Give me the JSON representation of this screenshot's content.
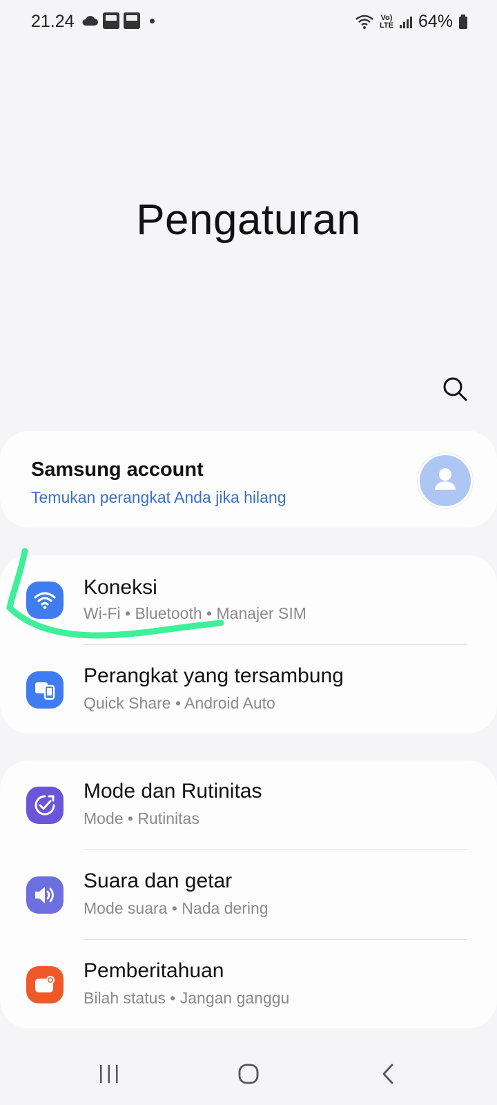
{
  "status_bar": {
    "time": "21.24",
    "battery_percent": "64%",
    "lte_top": "Vo)",
    "lte_bottom": "LTE"
  },
  "page": {
    "title": "Pengaturan"
  },
  "account": {
    "title": "Samsung account",
    "subtitle": "Temukan perangkat Anda jika hilang"
  },
  "groups": [
    {
      "items": [
        {
          "title": "Koneksi",
          "subtitle": "Wi-Fi  •  Bluetooth  •  Manajer SIM",
          "icon": "wifi-icon",
          "color": "#3e7cf0"
        },
        {
          "title": "Perangkat yang tersambung",
          "subtitle": "Quick Share  •  Android Auto",
          "icon": "devices-icon",
          "color": "#3e7cf0"
        }
      ]
    },
    {
      "items": [
        {
          "title": "Mode dan Rutinitas",
          "subtitle": "Mode  •  Rutinitas",
          "icon": "routine-icon",
          "color": "#6b55d8"
        },
        {
          "title": "Suara dan getar",
          "subtitle": "Mode suara  •  Nada dering",
          "icon": "speaker-icon",
          "color": "#6b6fe0"
        },
        {
          "title": "Pemberitahuan",
          "subtitle": "Bilah status  •  Jangan ganggu",
          "icon": "notification-icon",
          "color": "#f0582a"
        }
      ]
    }
  ],
  "colors": {
    "background": "#f5f5f7",
    "card": "#fdfdfd",
    "link": "#3a6fc9",
    "highlight_stroke": "#3ef09a"
  }
}
